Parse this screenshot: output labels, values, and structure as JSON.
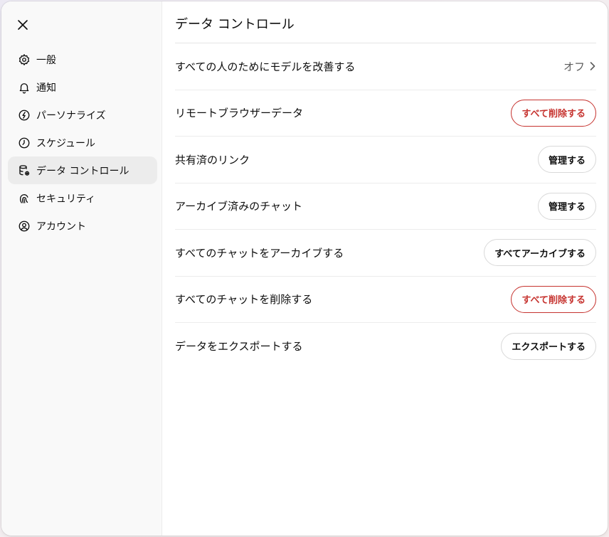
{
  "sidebar": {
    "close_label": "",
    "items": [
      {
        "label": "一般",
        "icon": "gear-icon"
      },
      {
        "label": "通知",
        "icon": "bell-icon"
      },
      {
        "label": "パーソナライズ",
        "icon": "personalize-icon"
      },
      {
        "label": "スケジュール",
        "icon": "clock-icon"
      },
      {
        "label": "データ コントロール",
        "icon": "database-gear-icon",
        "active": true
      },
      {
        "label": "セキュリティ",
        "icon": "security-icon"
      },
      {
        "label": "アカウント",
        "icon": "account-icon"
      }
    ]
  },
  "main": {
    "title": "データ コントロール",
    "rows": [
      {
        "label": "すべての人のためにモデルを改善する",
        "value": "オフ"
      },
      {
        "label": "リモートブラウザーデータ",
        "button": "すべて削除する"
      },
      {
        "label": "共有済のリンク",
        "button": "管理する"
      },
      {
        "label": "アーカイブ済みのチャット",
        "button": "管理する"
      },
      {
        "label": "すべてのチャットをアーカイブする",
        "button": "すべてアーカイブする"
      },
      {
        "label": "すべてのチャットを削除する",
        "button": "すべて削除する"
      },
      {
        "label": "データをエクスポートする",
        "button": "エクスポートする"
      }
    ]
  },
  "colors": {
    "danger": "#c6332f",
    "active_bg": "#ececec",
    "sidebar_bg": "#f9f9f9"
  }
}
